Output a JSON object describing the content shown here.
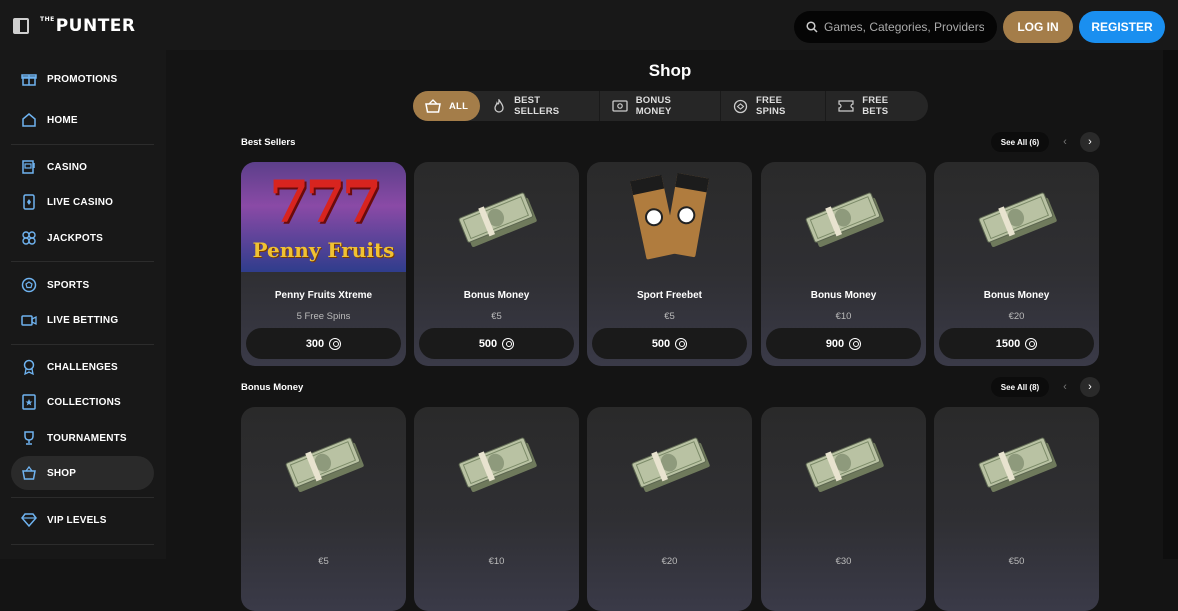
{
  "header": {
    "logo_small": "THE",
    "logo": "PUNTER",
    "search_placeholder": "Games, Categories, Providers",
    "login_label": "LOG IN",
    "register_label": "REGISTER"
  },
  "sidebar": {
    "items": [
      {
        "label": "PROMOTIONS",
        "icon": "gift-icon"
      },
      {
        "label": "HOME",
        "icon": "home-icon"
      },
      {
        "label": "CASINO",
        "icon": "slot-machine-icon"
      },
      {
        "label": "LIVE CASINO",
        "icon": "card-icon"
      },
      {
        "label": "JACKPOTS",
        "icon": "clover-icon"
      },
      {
        "label": "SPORTS",
        "icon": "football-icon"
      },
      {
        "label": "LIVE BETTING",
        "icon": "video-icon"
      },
      {
        "label": "CHALLENGES",
        "icon": "badge-icon"
      },
      {
        "label": "COLLECTIONS",
        "icon": "star-card-icon"
      },
      {
        "label": "TOURNAMENTS",
        "icon": "trophy-icon"
      },
      {
        "label": "SHOP",
        "icon": "basket-icon"
      },
      {
        "label": "VIP LEVELS",
        "icon": "diamond-icon"
      }
    ]
  },
  "main": {
    "title": "Shop",
    "tabs": [
      {
        "label": "ALL",
        "icon": "basket-icon"
      },
      {
        "label": "BEST SELLERS",
        "icon": "flame-icon"
      },
      {
        "label": "BONUS MONEY",
        "icon": "cash-icon"
      },
      {
        "label": "FREE SPINS",
        "icon": "spin-icon"
      },
      {
        "label": "FREE BETS",
        "icon": "ticket-icon"
      }
    ],
    "sections": [
      {
        "title": "Best Sellers",
        "see_all": "See All (6)",
        "cards": [
          {
            "name": "Penny Fruits Xtreme",
            "sub": "5 Free Spins",
            "price": "300",
            "image": "penny-fruits"
          },
          {
            "name": "Bonus Money",
            "sub": "€5",
            "price": "500",
            "image": "cash-stack"
          },
          {
            "name": "Sport Freebet",
            "sub": "€5",
            "price": "500",
            "image": "tickets"
          },
          {
            "name": "Bonus Money",
            "sub": "€10",
            "price": "900",
            "image": "cash-stack"
          },
          {
            "name": "Bonus Money",
            "sub": "€20",
            "price": "1500",
            "image": "cash-stack"
          }
        ]
      },
      {
        "title": "Bonus Money",
        "see_all": "See All (8)",
        "cards": [
          {
            "name": "",
            "sub": "€5",
            "price": "",
            "image": "cash-stack"
          },
          {
            "name": "",
            "sub": "€10",
            "price": "",
            "image": "cash-stack"
          },
          {
            "name": "",
            "sub": "€20",
            "price": "",
            "image": "cash-stack"
          },
          {
            "name": "",
            "sub": "€30",
            "price": "",
            "image": "cash-stack"
          },
          {
            "name": "",
            "sub": "€50",
            "price": "",
            "image": "cash-stack"
          }
        ]
      }
    ],
    "penny_image_text": {
      "sevens": "777",
      "title": "Penny Fruits"
    }
  },
  "colors": {
    "accent_gold": "#a47d49",
    "register_blue": "#1a8ff0",
    "background": "#141414",
    "panel": "#181818"
  }
}
